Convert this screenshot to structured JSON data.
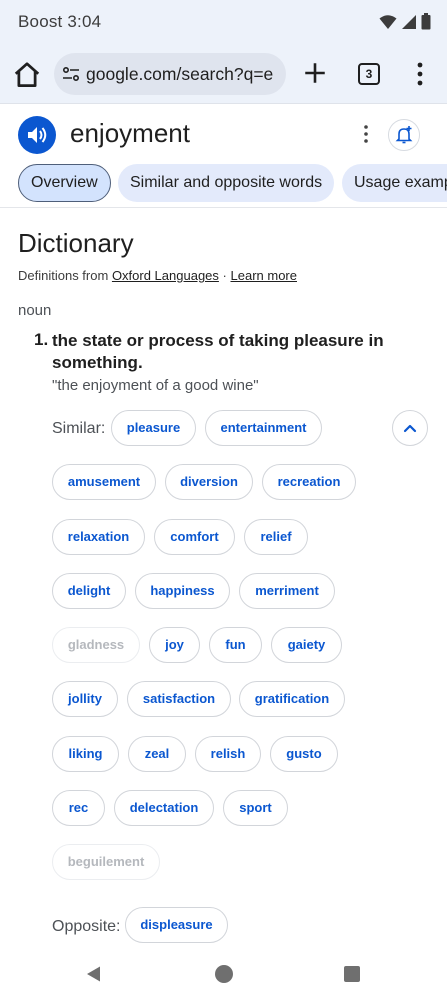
{
  "status_bar": {
    "carrier_time": "Boost 3:04"
  },
  "toolbar": {
    "url": "google.com/search?q=e",
    "tab_count": "3"
  },
  "entity": {
    "title": "enjoyment"
  },
  "tabs": [
    {
      "label": "Overview"
    },
    {
      "label": "Similar and opposite words"
    },
    {
      "label": "Usage examp"
    }
  ],
  "dictionary": {
    "title": "Dictionary",
    "definitions_from": "Definitions from",
    "source": "Oxford Languages",
    "separator": "·",
    "learn_more": "Learn more",
    "part_of_speech": "noun",
    "definition_number": "1.",
    "definition": "the state or process of taking pleasure in something.",
    "example": "\"the enjoyment of a good wine\"",
    "similar_label": "Similar:",
    "opposite_label": "Opposite:",
    "similar": [
      {
        "word": "pleasure"
      },
      {
        "word": "entertainment"
      },
      {
        "word": "amusement"
      },
      {
        "word": "diversion"
      },
      {
        "word": "recreation"
      },
      {
        "word": "relaxation"
      },
      {
        "word": "comfort"
      },
      {
        "word": "relief"
      },
      {
        "word": "delight"
      },
      {
        "word": "happiness"
      },
      {
        "word": "merriment"
      },
      {
        "word": "gladness",
        "disabled": true
      },
      {
        "word": "joy"
      },
      {
        "word": "fun"
      },
      {
        "word": "gaiety"
      },
      {
        "word": "jollity"
      },
      {
        "word": "satisfaction"
      },
      {
        "word": "gratification"
      },
      {
        "word": "liking"
      },
      {
        "word": "zeal"
      },
      {
        "word": "relish"
      },
      {
        "word": "gusto"
      },
      {
        "word": "rec"
      },
      {
        "word": "delectation"
      },
      {
        "word": "sport"
      },
      {
        "word": "beguilement",
        "disabled": true
      }
    ],
    "opposite": [
      {
        "word": "displeasure"
      }
    ]
  },
  "colors": {
    "accent": "#0b57d0",
    "chrome_bg": "#edf2fa"
  },
  "icons": [
    "signal-icon",
    "wifi-icon",
    "battery-icon",
    "home-icon",
    "site-settings-icon",
    "new-tab-icon",
    "tab-switcher-icon",
    "menu-icon",
    "speaker-icon",
    "more-vert-icon",
    "bell-add-icon",
    "chevron-up-icon",
    "back-icon",
    "home-nav-icon",
    "recents-icon"
  ]
}
